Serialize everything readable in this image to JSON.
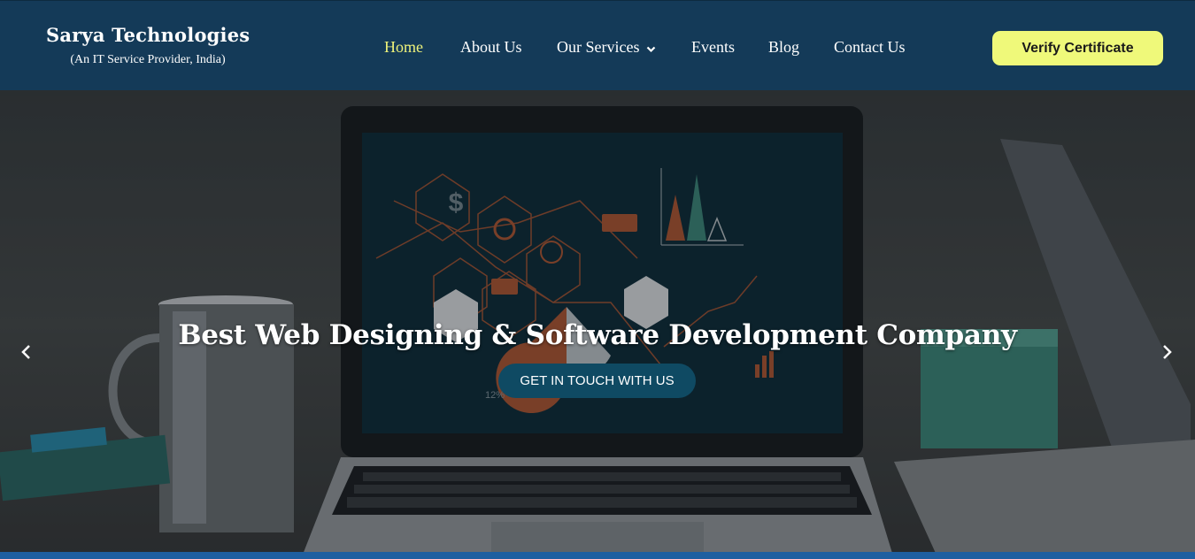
{
  "brand": {
    "name": "Sarya Technologies",
    "tagline": "(An IT Service Provider, India)"
  },
  "nav": {
    "items": [
      {
        "label": "Home",
        "active": true
      },
      {
        "label": "About Us"
      },
      {
        "label": "Our Services",
        "has_dropdown": true
      },
      {
        "label": "Events"
      },
      {
        "label": "Blog"
      },
      {
        "label": "Contact Us"
      }
    ],
    "cta_label": "Verify Certificate"
  },
  "hero": {
    "title": "Best Web Designing & Software Development Company",
    "cta_label": "GET IN TOUCH WITH US",
    "screen_overlay_percent": "12%"
  },
  "colors": {
    "navbar_bg": "#143a58",
    "active_link": "#eef27a",
    "verify_button": "#eff97a",
    "cta_button": "#0f4a63"
  },
  "icons": [
    "chevron-down-icon",
    "arrow-left-icon",
    "arrow-right-icon"
  ]
}
